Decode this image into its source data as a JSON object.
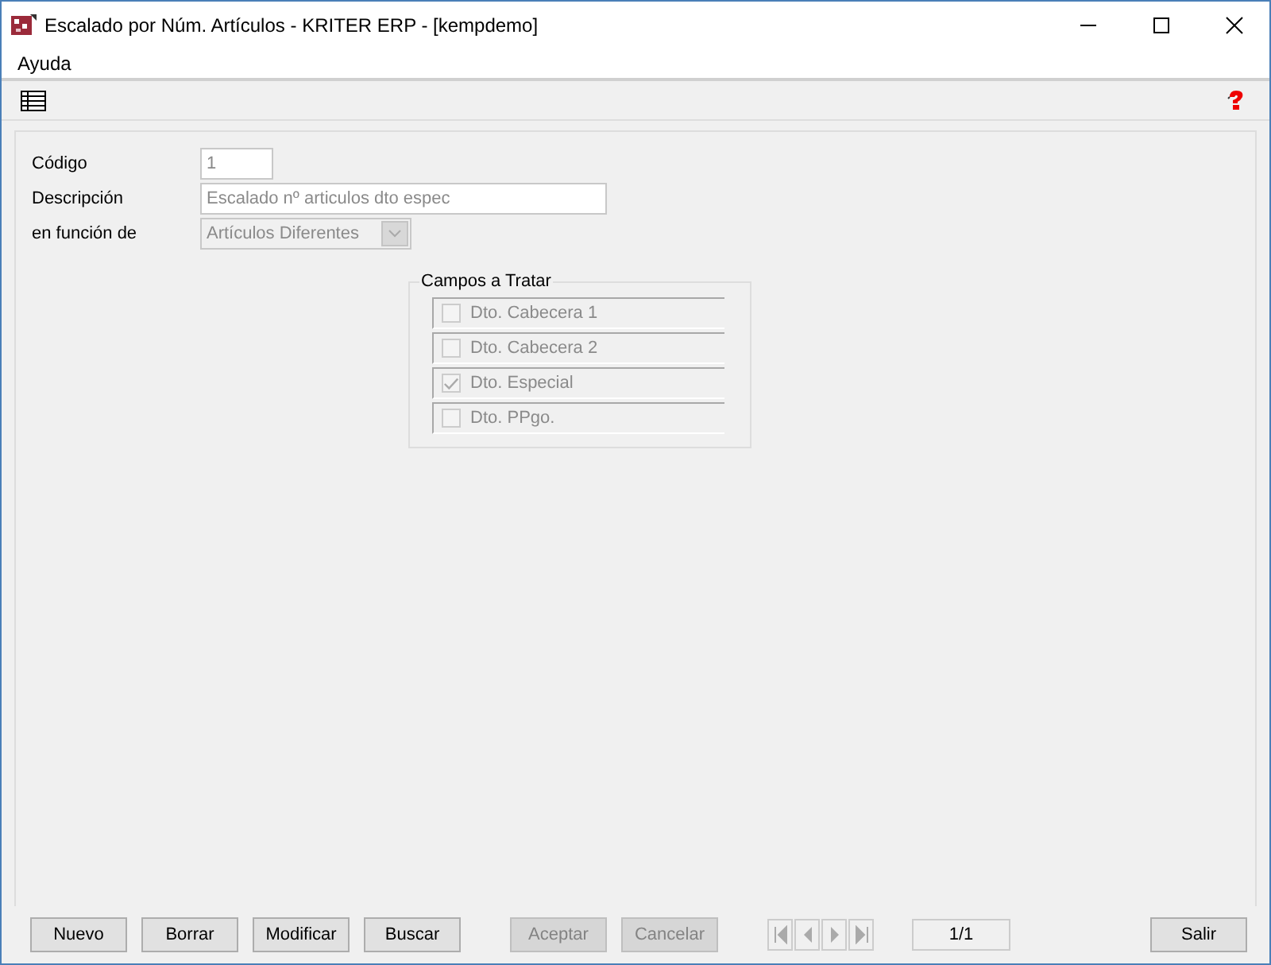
{
  "window": {
    "title": "Escalado por Núm. Artículos - KRITER ERP - [kempdemo]"
  },
  "menu": [
    "Ayuda"
  ],
  "form": {
    "fields": [
      {
        "label": "Código",
        "value": "1",
        "kind": "text"
      },
      {
        "label": "Descripción",
        "value": "Escalado nº articulos dto espec",
        "kind": "text"
      },
      {
        "label": "en función de",
        "value": "Artículos Diferentes",
        "kind": "select"
      }
    ]
  },
  "group": {
    "title": "Campos a Tratar",
    "items": [
      {
        "label": "Dto. Cabecera 1",
        "checked": false
      },
      {
        "label": "Dto. Cabecera 2",
        "checked": false
      },
      {
        "label": "Dto. Especial",
        "checked": true
      },
      {
        "label": "Dto. PPgo.",
        "checked": false
      }
    ]
  },
  "buttons": [
    {
      "label": "Nuevo",
      "disabled": false
    },
    {
      "label": "Borrar",
      "disabled": false
    },
    {
      "label": "Modificar",
      "disabled": false
    },
    {
      "label": "Buscar",
      "disabled": false
    },
    {
      "label": "Aceptar",
      "disabled": true
    },
    {
      "label": "Cancelar",
      "disabled": true
    }
  ],
  "record_counter": "1/1",
  "exit_button": {
    "label": "Salir",
    "disabled": false
  }
}
